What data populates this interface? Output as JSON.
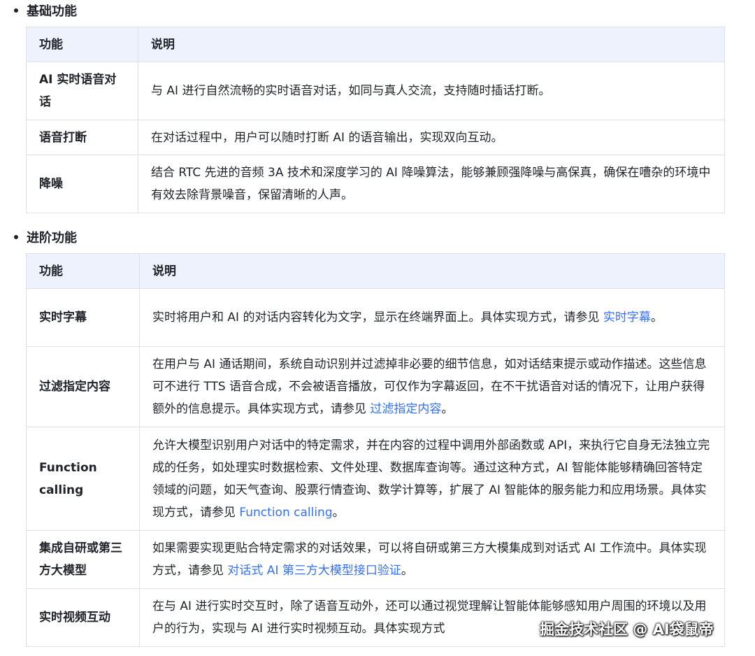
{
  "sections": {
    "basic": {
      "title": "基础功能",
      "headers": [
        "功能",
        "说明"
      ],
      "rows": [
        {
          "feature": "AI 实时语音对话",
          "desc": "与 AI 进行自然流畅的实时语音对话，如同与真人交流，支持随时插话打断。"
        },
        {
          "feature": "语音打断",
          "desc": "在对话过程中，用户可以随时打断 AI 的语音输出，实现双向互动。"
        },
        {
          "feature": "降噪",
          "desc": "结合 RTC 先进的音频 3A 技术和深度学习的 AI 降噪算法，能够兼顾强降噪与高保真，确保在嘈杂的环境中有效去除背景噪音，保留清晰的人声。"
        }
      ]
    },
    "advanced": {
      "title": "进阶功能",
      "headers": [
        "功能",
        "说明"
      ],
      "rows": [
        {
          "feature": "实时字幕",
          "desc": "实时将用户和 AI 的对话内容转化为文字，显示在终端界面上。具体实现方式，请参见 ",
          "link": "实时字幕",
          "tail": "。"
        },
        {
          "feature": "过滤指定内容",
          "desc": "在用户与 AI 通话期间，系统自动识别并过滤掉非必要的细节信息，如对话结束提示或动作描述。这些信息可不进行 TTS 语音合成，不会被语音播放，可仅作为字幕返回，在不干扰语音对话的情况下，让用户获得额外的信息提示。具体实现方式，请参见 ",
          "link": "过滤指定内容",
          "tail": "。"
        },
        {
          "feature": "Function calling",
          "desc": "允许大模型识别用户对话中的特定需求，并在内容的过程中调用外部函数或 API，来执行它自身无法独立完成的任务，如处理实时数据检索、文件处理、数据库查询等。通过这种方式，AI 智能体能够精确回答特定领域的问题，如天气查询、股票行情查询、数学计算等，扩展了 AI 智能体的服务能力和应用场景。具体实现方式，请参见 ",
          "link": "Function calling",
          "tail": "。"
        },
        {
          "feature": "集成自研或第三方大模型",
          "desc": "如果需要实现更贴合特定需求的对话效果，可以将自研或第三方大模集成到对话式 AI 工作流中。具体实现方式，请参见 ",
          "link": "对话式 AI 第三方大模型接口验证",
          "tail": "。"
        },
        {
          "feature": "实时视频互动",
          "desc": "在与 AI 进行实时交互时，除了语音互动外，还可以通过视觉理解让智能体能够感知用户周围的环境以及用户的行为，实现与 AI 进行实时视频互动。具体实现方式",
          "link": "",
          "tail": ""
        }
      ]
    }
  },
  "watermark": "掘金技术社区 @ AI袋鼠帝"
}
